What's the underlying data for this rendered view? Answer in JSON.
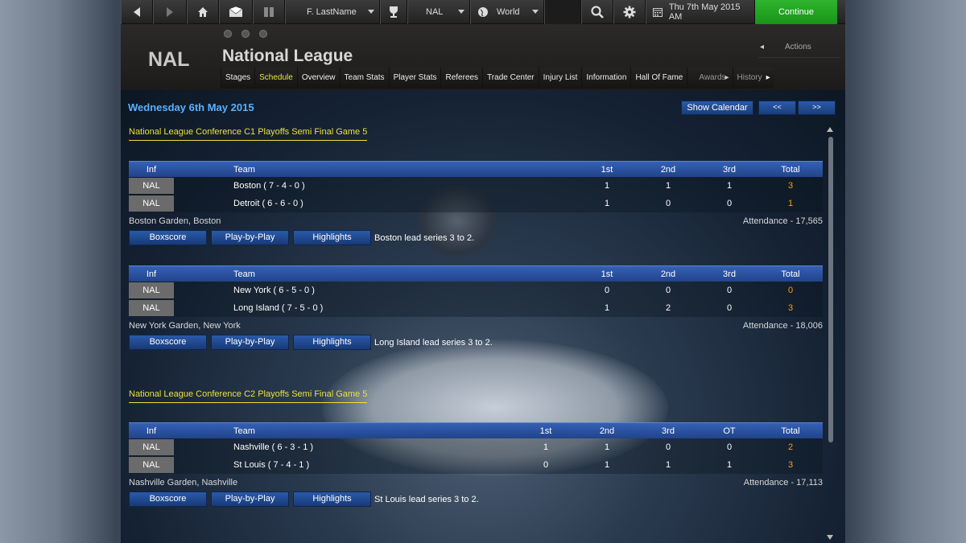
{
  "topbar": {
    "profile": "F. LastName",
    "league_select": "NAL",
    "region_select": "World",
    "datetime": "Thu 7th May 2015 AM",
    "continue": "Continue"
  },
  "header": {
    "logo": "NAL",
    "title": "National League",
    "actions": "Actions",
    "nav": [
      "Stages",
      "Schedule",
      "Overview",
      "Team Stats",
      "Player Stats",
      "Referees",
      "Trade Center",
      "Injury List",
      "Information",
      "Hall Of Fame",
      "Awards",
      "History"
    ]
  },
  "content": {
    "date": "Wednesday 6th May 2015",
    "show_calendar": "Show Calendar",
    "prev": "<<",
    "next": ">>",
    "sections": [
      {
        "title": "National League Conference C1 Playoffs Semi Final Game 5",
        "games": [
          {
            "headers": [
              "Inf",
              "Team",
              "1st",
              "2nd",
              "3rd",
              "Total"
            ],
            "rows": [
              {
                "inf": "NAL",
                "team": "Boston  ( 7 - 4 - 0 )",
                "periods": [
                  "1",
                  "1",
                  "1"
                ],
                "total": "3"
              },
              {
                "inf": "NAL",
                "team": "Detroit  ( 6 - 6 - 0 )",
                "periods": [
                  "1",
                  "0",
                  "0"
                ],
                "total": "1"
              }
            ],
            "venue": "Boston Garden, Boston",
            "attendance": "Attendance - 17,565",
            "buttons": [
              "Boxscore",
              "Play-by-Play",
              "Highlights"
            ],
            "series": "Boston lead series 3 to 2."
          },
          {
            "headers": [
              "Inf",
              "Team",
              "1st",
              "2nd",
              "3rd",
              "Total"
            ],
            "rows": [
              {
                "inf": "NAL",
                "team": "New York  ( 6 - 5 - 0 )",
                "periods": [
                  "0",
                  "0",
                  "0"
                ],
                "total": "0"
              },
              {
                "inf": "NAL",
                "team": "Long Island  ( 7 - 5 - 0 )",
                "periods": [
                  "1",
                  "2",
                  "0"
                ],
                "total": "3"
              }
            ],
            "venue": "New York Garden, New York",
            "attendance": "Attendance - 18,006",
            "buttons": [
              "Boxscore",
              "Play-by-Play",
              "Highlights"
            ],
            "series": "Long Island lead series 3 to 2."
          }
        ]
      },
      {
        "title": "National League Conference C2 Playoffs Semi Final Game 5",
        "games": [
          {
            "headers": [
              "Inf",
              "Team",
              "1st",
              "2nd",
              "3rd",
              "OT",
              "Total"
            ],
            "rows": [
              {
                "inf": "NAL",
                "team": "Nashville  ( 6 - 3 - 1 )",
                "periods": [
                  "1",
                  "1",
                  "0",
                  "0"
                ],
                "total": "2"
              },
              {
                "inf": "NAL",
                "team": "St Louis  ( 7 - 4 - 1 )",
                "periods": [
                  "0",
                  "1",
                  "1",
                  "1"
                ],
                "total": "3"
              }
            ],
            "venue": "Nashville Garden, Nashville",
            "attendance": "Attendance - 17,113",
            "buttons": [
              "Boxscore",
              "Play-by-Play",
              "Highlights"
            ],
            "series": "St Louis lead series 3 to 2."
          }
        ]
      }
    ]
  },
  "colors": {
    "accent_blue": "#2a5aa9",
    "title_yellow": "#e9e13c",
    "total_orange": "#ff9a1f",
    "continue_green": "#2fb52f"
  },
  "icons": [
    "back-arrow-icon",
    "forward-arrow-icon",
    "home-icon",
    "mail-icon",
    "book-icon",
    "trophy-icon",
    "globe-icon",
    "search-icon",
    "gear-icon",
    "calendar-icon"
  ]
}
